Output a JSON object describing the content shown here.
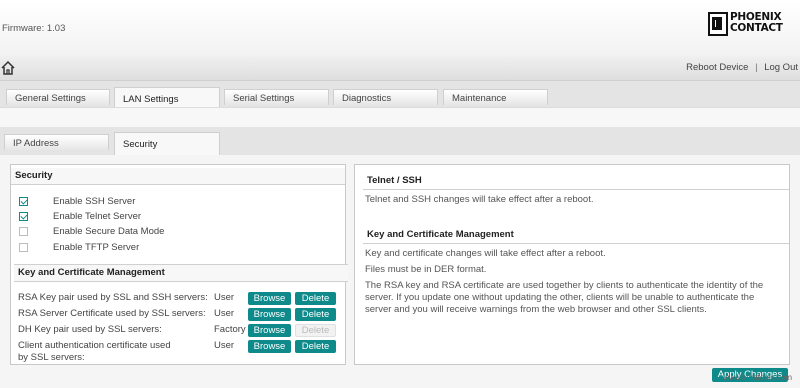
{
  "header": {
    "firmware": "Firmware: 1.03",
    "logo_line1": "PHOENIX",
    "logo_line2": "CONTACT"
  },
  "nav": {
    "reboot": "Reboot Device",
    "separator": "|",
    "logout": "Log Out"
  },
  "main_tabs": [
    {
      "label": "General Settings",
      "active": false
    },
    {
      "label": "LAN Settings",
      "active": true
    },
    {
      "label": "Serial Settings",
      "active": false
    },
    {
      "label": "Diagnostics",
      "active": false
    },
    {
      "label": "Maintenance",
      "active": false
    }
  ],
  "sub_tabs": [
    {
      "label": "IP Address",
      "active": false
    },
    {
      "label": "Security",
      "active": true
    }
  ],
  "security": {
    "title": "Security",
    "options": [
      {
        "label": "Enable SSH Server",
        "checked": true
      },
      {
        "label": "Enable Telnet Server",
        "checked": true
      },
      {
        "label": "Enable Secure Data Mode",
        "checked": false
      },
      {
        "label": "Enable TFTP Server",
        "checked": false
      }
    ]
  },
  "keymgmt": {
    "title": "Key and Certificate Management",
    "browse_label": "Browse",
    "delete_label": "Delete",
    "rows": [
      {
        "label": "RSA Key pair used by SSL and SSH servers:",
        "source": "User",
        "delete_enabled": true
      },
      {
        "label": "RSA Server Certificate used by SSL servers:",
        "source": "User",
        "delete_enabled": true
      },
      {
        "label": "DH Key pair used by SSL servers:",
        "source": "Factory",
        "delete_enabled": false
      },
      {
        "label_line1": "Client authentication certificate used",
        "label_line2": "by SSL servers:",
        "source": "User",
        "delete_enabled": true
      }
    ]
  },
  "info": {
    "telnet_title": "Telnet / SSH",
    "telnet_text": "Telnet and SSH changes will take effect after a reboot.",
    "key_title": "Key and Certificate Management",
    "key_text1": "Key and certificate changes will take effect after a reboot.",
    "key_text2": "Files must be in DER format.",
    "key_text3_line1": "The RSA key and RSA certificate are used together by clients to authenticate the identity of the",
    "key_text3_line2": "server. If you update one without updating the other, clients will be unable to authenticate the",
    "key_text3_line3": "server and you will receive warnings from the web browser and other SSL clients."
  },
  "apply_button": "Apply Changes",
  "watermark": "www.lnfrdfobis.com",
  "colors": {
    "accent": "#0f8a8a",
    "tab_bg": "#e4e4e4"
  }
}
